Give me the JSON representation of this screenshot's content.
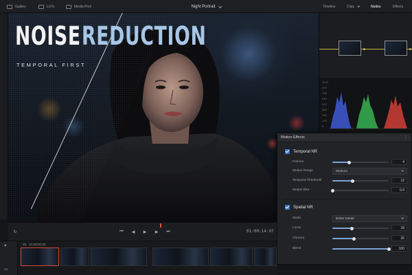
{
  "topbar": {
    "left_tabs": [
      {
        "label": "Gallery",
        "icon": "gallery-icon"
      },
      {
        "label": "LUTs",
        "icon": "luts-icon"
      },
      {
        "label": "Media Pool",
        "icon": "media-pool-icon"
      }
    ],
    "project_title": "Night Portrait",
    "right_tabs": [
      "Timeline",
      "Clips",
      "Nodes",
      "Effects"
    ],
    "active_right_tab": "Nodes"
  },
  "viewer": {
    "title_word1": "NOISE",
    "title_word2": "REDUCTION",
    "subtitle": "TEMPORAL FIRST"
  },
  "scopes": {
    "labels": [
      "1023",
      "896",
      "768",
      "640",
      "512",
      "384",
      "256",
      "128",
      "0"
    ]
  },
  "motion_effects": {
    "title": "Motion Effects",
    "temporal": {
      "label": "Temporal NR",
      "enabled": true,
      "frames": {
        "label": "Frames",
        "value": "4",
        "fraction": 0.3
      },
      "motion_range": {
        "label": "Motion Range",
        "value": "Medium"
      },
      "temporal_threshold": {
        "label": "Temporal Threshold",
        "value": "12",
        "fraction": 0.36
      },
      "motion_blur": {
        "label": "Motion Blur",
        "value": "0.0",
        "fraction": 0.0
      }
    },
    "spatial": {
      "label": "Spatial NR",
      "enabled": true,
      "mode": {
        "label": "Mode",
        "value": "Better Detail"
      },
      "luma": {
        "label": "Luma",
        "value": "18",
        "fraction": 0.35
      },
      "chroma": {
        "label": "Chroma",
        "value": "26",
        "fraction": 0.38
      },
      "blend": {
        "label": "Blend",
        "value": "100",
        "fraction": 1.0
      }
    }
  },
  "transport": {
    "timecode": "01:00:14:07"
  },
  "timeline": {
    "track": "V1",
    "track_timecode": "01:00:00:00",
    "video_track_label": "V1"
  },
  "colors": {
    "accent": "#3a78c8",
    "slider": "#7ba4d6",
    "selection": "#d9483a",
    "node_link": "#c8b54a"
  }
}
